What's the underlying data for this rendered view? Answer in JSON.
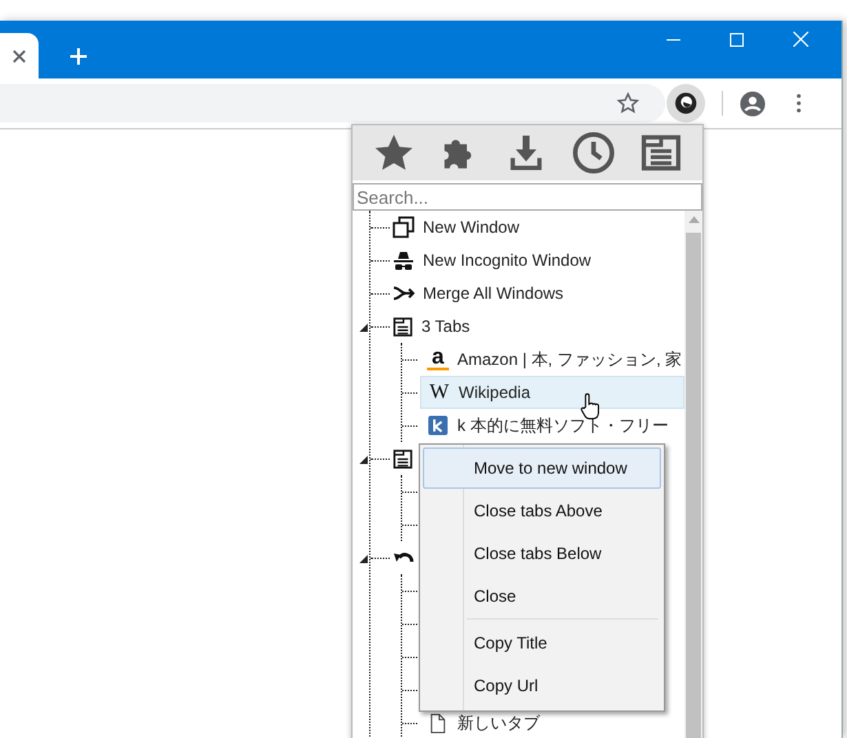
{
  "popup": {
    "search": {
      "placeholder": "Search..."
    },
    "tree": [
      {
        "kind": "new-window",
        "label": "New Window"
      },
      {
        "kind": "incognito",
        "label": "New Incognito Window"
      },
      {
        "kind": "merge",
        "label": "Merge All Windows"
      },
      {
        "kind": "window",
        "label": "3 Tabs",
        "expanded": true,
        "children": [
          {
            "kind": "amazon",
            "icon": "a",
            "label": "Amazon | 本, ファッション, 家",
            "selected": false
          },
          {
            "kind": "wiki",
            "icon": "W",
            "label": "Wikipedia",
            "selected": true
          },
          {
            "kind": "k-site",
            "label": "k 本的に無料ソフト・フリー",
            "selected": false
          }
        ]
      },
      {
        "kind": "window",
        "expanded": true,
        "children": [
          {
            "kind": "tab"
          },
          {
            "kind": "tab"
          }
        ]
      },
      {
        "kind": "closed",
        "expanded": true,
        "children": [
          {
            "kind": "tab"
          },
          {
            "kind": "tab"
          },
          {
            "kind": "tab"
          },
          {
            "kind": "tab"
          },
          {
            "kind": "page",
            "label": "新しいタブ",
            "selected": false
          }
        ]
      }
    ],
    "context_menu": [
      {
        "label": "Move to new window",
        "selected": true
      },
      {
        "label": "Close tabs Above",
        "selected": false
      },
      {
        "label": "Close tabs Below",
        "selected": false
      },
      {
        "label": "Close",
        "selected": false
      },
      {
        "label": "Copy Title",
        "selected": false,
        "separator_before": true
      },
      {
        "label": "Copy Url",
        "selected": false
      }
    ]
  }
}
